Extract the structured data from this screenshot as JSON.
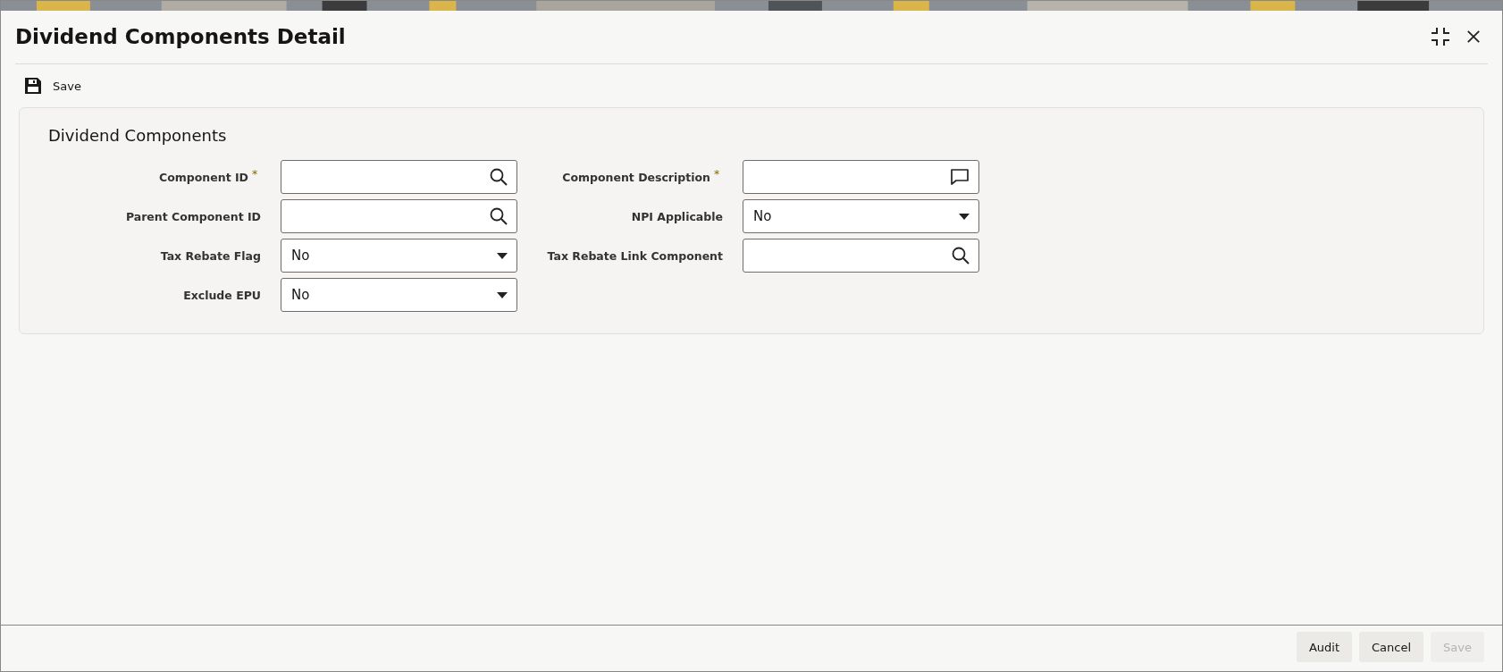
{
  "window": {
    "title": "Dividend Components Detail"
  },
  "toolbar": {
    "save": "Save"
  },
  "section": {
    "title": "Dividend Components",
    "fields": [
      {
        "label": "Component ID",
        "required_mark": "*",
        "kind": "lookup"
      },
      {
        "label": "Component Description",
        "required_mark": "*",
        "kind": "description"
      },
      {
        "label": "Parent Component ID",
        "kind": "lookup"
      },
      {
        "label": "NPI Applicable",
        "kind": "select",
        "value": "No"
      },
      {
        "label": "Tax Rebate Flag",
        "kind": "select",
        "value": "No"
      },
      {
        "label": "Tax Rebate Link Component",
        "kind": "lookup"
      },
      {
        "label": "Exclude EPU",
        "kind": "select",
        "value": "No"
      }
    ]
  },
  "footer": {
    "buttons": [
      {
        "label": "Audit",
        "disabled": false
      },
      {
        "label": "Cancel",
        "disabled": false
      },
      {
        "label": "Save",
        "disabled": true
      }
    ]
  }
}
